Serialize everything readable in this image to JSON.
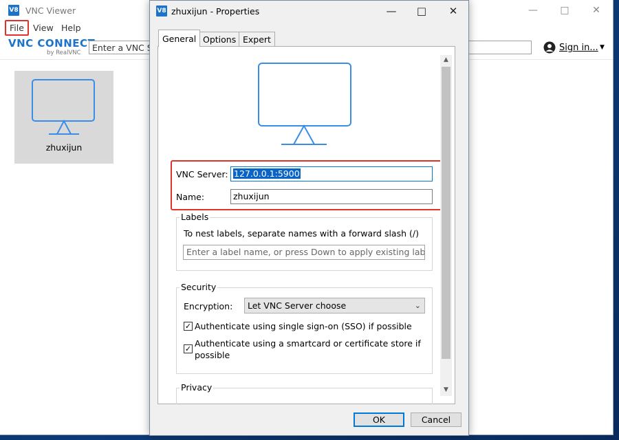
{
  "main_window": {
    "title": "VNC Viewer",
    "app_icon": "V8",
    "menu": [
      "File",
      "View",
      "Help"
    ],
    "brand": {
      "name": "VNC CONNECT",
      "by": "by RealVNC"
    },
    "search_placeholder": "Enter a VNC Se",
    "sign_in": "Sign in...",
    "connection_tile": {
      "name": "zhuxijun",
      "icon": "monitor-icon"
    }
  },
  "dialog": {
    "title": "zhuxijun - Properties",
    "app_icon": "V8",
    "tabs": [
      "General",
      "Options",
      "Expert"
    ],
    "active_tab": "General",
    "vnc_server_label": "VNC Server:",
    "vnc_server_value": "127.0.0.1:5900",
    "name_label": "Name:",
    "name_value": "zhuxijun",
    "labels": {
      "title": "Labels",
      "hint": "To nest labels, separate names with a forward slash (/)",
      "placeholder": "Enter a label name, or press Down to apply existing labels"
    },
    "security": {
      "title": "Security",
      "encryption_label": "Encryption:",
      "encryption_value": "Let VNC Server choose",
      "sso_label": "Authenticate using single sign-on (SSO) if possible",
      "sso_checked": true,
      "smartcard_label_1": "Authenticate using a smartcard or certificate store if",
      "smartcard_label_2": "possible",
      "smartcard_checked": true
    },
    "privacy": {
      "title": "Privacy"
    },
    "ok": "OK",
    "cancel": "Cancel"
  },
  "colors": {
    "accent": "#1d73c9",
    "highlight": "#e0322c",
    "selection": "#0a64c8",
    "focus": "#0078d7"
  }
}
